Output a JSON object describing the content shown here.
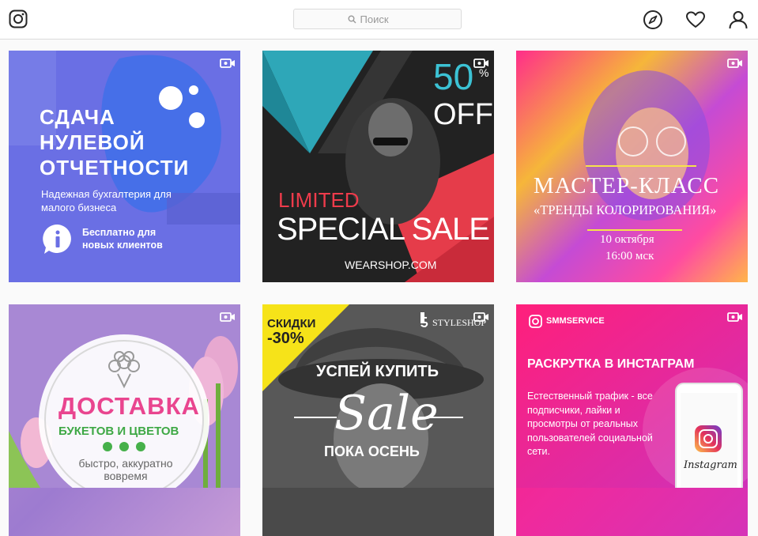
{
  "header": {
    "search_placeholder": "Поиск"
  },
  "posts": [
    {
      "line1": "СДАЧА",
      "line2": "НУЛЕВОЙ",
      "line3": "ОТЧЕТНОСТИ",
      "sub1": "Надежная бухгалтерия для",
      "sub2": "малого бизнеса",
      "cta1": "Бесплатно для",
      "cta2": "новых клиентов"
    },
    {
      "big": "50",
      "pct": "%",
      "off": "OFF",
      "limited": "LIMITED",
      "sale": "SPECIAL SALE",
      "site": "WEARSHOP.COM"
    },
    {
      "title": "МАСТЕР-КЛАСС",
      "subtitle": "«ТРЕНДЫ КОЛОРИРОВАНИЯ»",
      "date": "10 октября",
      "time": "16:00 мск"
    },
    {
      "title": "ДОСТАВКА",
      "subtitle": "БУКЕТОВ И ЦВЕТОВ",
      "note1": "быстро, аккуратно",
      "note2": "вовремя"
    },
    {
      "discount1": "СКИДКИ",
      "discount2": "-30%",
      "brand": "STYLESHOP",
      "headline": "УСПЕЙ КУПИТЬ",
      "script": "Sale",
      "footer": "ПОКА ОСЕНЬ"
    },
    {
      "brand": "SMMSERVICE",
      "title": "РАСКРУТКА В ИНСТАГРАМ",
      "body1": "Естественный трафик - все",
      "body2": "подписчики, лайки и",
      "body3": "просмотры от реальных",
      "body4": "пользователей социальной",
      "body5": "сети.",
      "phone_label": "Instagram"
    }
  ]
}
